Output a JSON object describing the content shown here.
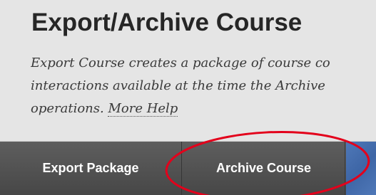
{
  "page": {
    "title": "Export/Archive Course",
    "description_lines": [
      "Export Course creates a package of course co",
      "interactions available at the time the Archive",
      "operations. "
    ],
    "more_help_label": "More Help"
  },
  "toolbar": {
    "export_package_label": "Export Package",
    "archive_course_label": "Archive Course"
  },
  "annotation": {
    "highlight_color": "#e3001b"
  }
}
